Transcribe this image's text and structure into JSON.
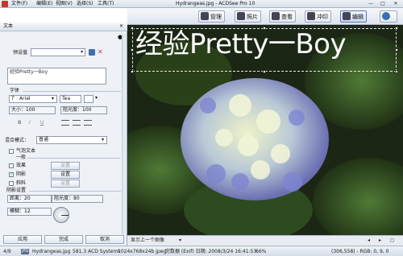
{
  "window": {
    "title": "Hydrangeas.jpg - ACDSee Pro 10",
    "menus": [
      "文件(F)",
      "编辑(E)",
      "视图(V)",
      "选择(S)",
      "工具(T)"
    ],
    "controls": [
      "—",
      "□",
      "✕"
    ]
  },
  "toolbar": {
    "modes": [
      {
        "label": "管理",
        "icon": "manage-icon"
      },
      {
        "label": "照片",
        "icon": "photos-icon"
      },
      {
        "label": "查看",
        "icon": "view-icon"
      },
      {
        "label": "冲印",
        "icon": "develop-icon"
      },
      {
        "label": "编辑",
        "icon": "edit-icon"
      },
      {
        "label": "",
        "icon": "globe-icon"
      }
    ]
  },
  "panel": {
    "title": "文本",
    "preset_label": "预设值",
    "text_value": "经验Pretty一Boy",
    "font_section": "字体",
    "font_name": "Arial",
    "font_style": "Tea",
    "size_label": "大小：100",
    "opacity_label": "阻光度：100",
    "format_buttons": [
      "B",
      "I",
      "U"
    ],
    "blend_label": "混合模式：",
    "blend_value": "普通",
    "bubble_label": "气泡文本",
    "effects_section": "一般",
    "effects": [
      {
        "label": "效果",
        "checked": false,
        "button": "设置",
        "enabled": false
      },
      {
        "label": "阴影",
        "checked": true,
        "button": "设置",
        "enabled": true
      },
      {
        "label": "斜料",
        "checked": false,
        "button": "设置",
        "enabled": false
      }
    ],
    "shadow_section": "阴影设置",
    "shadow_distance": "距离：20",
    "shadow_opacity": "阻光度：80",
    "shadow_blur": "模糊：12",
    "actions": [
      "应用",
      "完成",
      "取消"
    ]
  },
  "image": {
    "overlay_text": "经验Pretty一Boy",
    "nav_label": "显示上一个图像"
  },
  "status": {
    "index": "4/9",
    "filename": "Hydrangeas.jpg",
    "filesize": "581.3 ACD Systems",
    "dimensions": "1024x768x24b jpeg",
    "date": "完数据 (Exif) 日期: 2008/3/24 16:41:53",
    "zoom": "66%",
    "pixel": "(306,558) - RGB: 0, 9, 0"
  }
}
